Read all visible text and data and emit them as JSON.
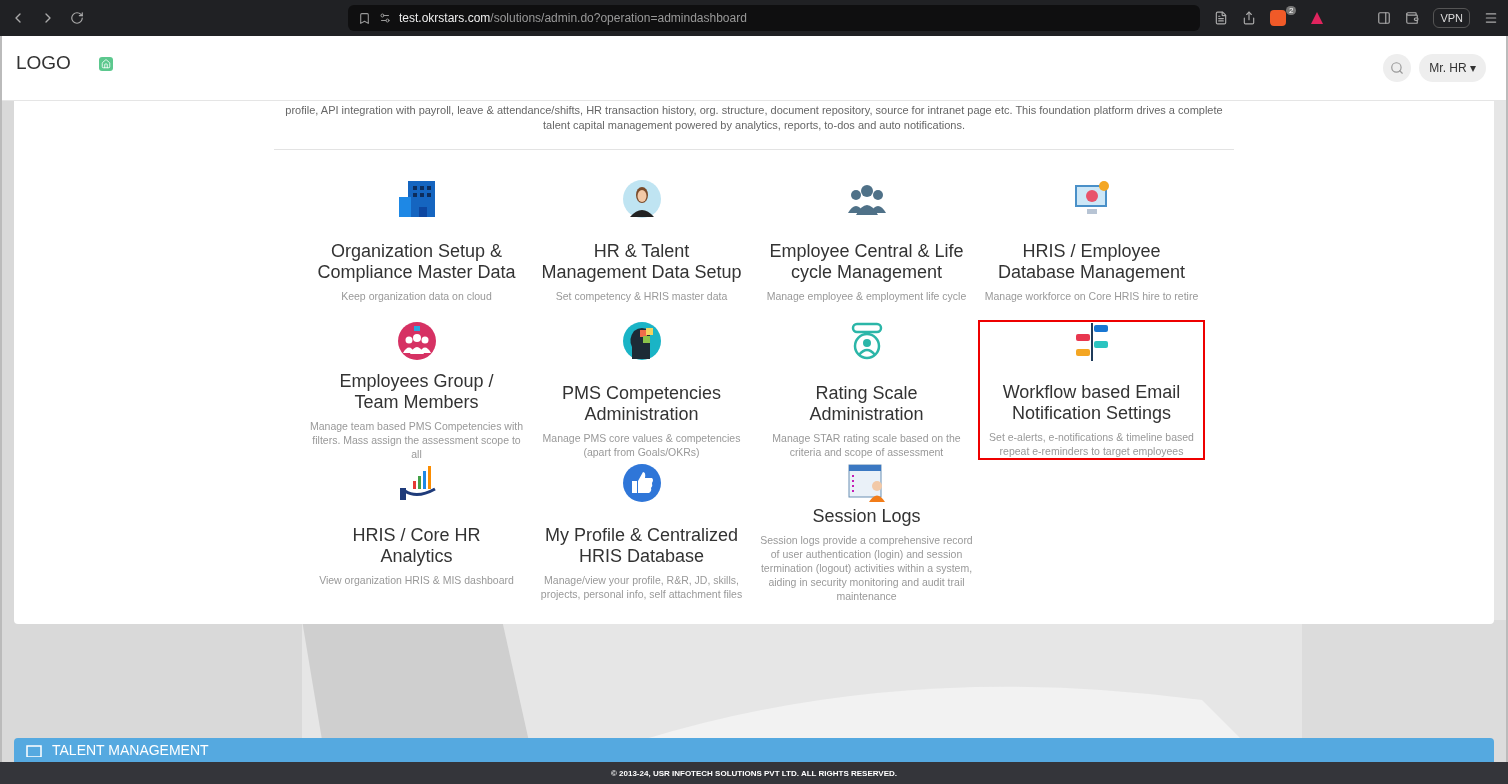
{
  "browser": {
    "url_host": "test.okrstars.com",
    "url_path": "/solutions/admin.do?operation=admindashboard",
    "shield_count": "2",
    "vpn": "VPN"
  },
  "header": {
    "logo": "LOGO",
    "user": "Mr. HR",
    "caret": "▾"
  },
  "intro": "profile, API integration with payroll, leave & attendance/shifts, HR transaction history, org. structure, document repository, source for intranet page etc. This foundation platform drives a complete talent capital management powered by analytics, reports, to-dos and auto notifications.",
  "modules": [
    {
      "kind": "building",
      "title": "Organization Setup & Compliance Master Data",
      "description": "Keep organization data on cloud",
      "highlighted": false
    },
    {
      "kind": "person",
      "title": "HR & Talent Management Data Setup",
      "description": "Set competency & HRIS master data",
      "highlighted": false
    },
    {
      "kind": "team",
      "title": "Employee Central & Life cycle Management",
      "description": "Manage employee & employment life cycle",
      "highlighted": false
    },
    {
      "kind": "monitor",
      "title": "HRIS / Employee Database Management",
      "description": "Manage workforce on Core HRIS hire to retire",
      "highlighted": false
    },
    {
      "kind": "group",
      "title": "Employees Group / Team Members",
      "description": "Manage team based PMS Competencies with filters. Mass assign the assessment scope to all",
      "highlighted": false
    },
    {
      "kind": "head",
      "title": "PMS Competencies Administration",
      "description": "Manage PMS core values & competencies (apart from Goals/OKRs)",
      "highlighted": false
    },
    {
      "kind": "rating",
      "title": "Rating Scale Administration",
      "description": "Manage STAR rating scale based on the criteria and scope of assessment",
      "highlighted": false
    },
    {
      "kind": "timeline",
      "title": "Workflow based Email Notification Settings",
      "description": "Set e-alerts, e-notifications & timeline based repeat e-reminders to target employees",
      "highlighted": true
    },
    {
      "kind": "analytics",
      "title": "HRIS / Core HR Analytics",
      "description": "View organization HRIS & MIS dashboard",
      "highlighted": false
    },
    {
      "kind": "thumb",
      "title": "My Profile & Centralized HRIS Database",
      "description": "Manage/view your profile, R&R, JD, skills, projects, personal info, self attachment files",
      "highlighted": false
    },
    {
      "kind": "logs",
      "title": "Session Logs",
      "description": "Session logs provide a comprehensive record of user authentication (login) and session termination (logout) activities within a system, aiding in security monitoring and audit trail maintenance",
      "highlighted": false
    }
  ],
  "banner": {
    "title": "TALENT MANAGEMENT"
  },
  "footer": "© 2013-24, USR INFOTECH SOLUTIONS PVT LTD. ALL RIGHTS RESERVED."
}
